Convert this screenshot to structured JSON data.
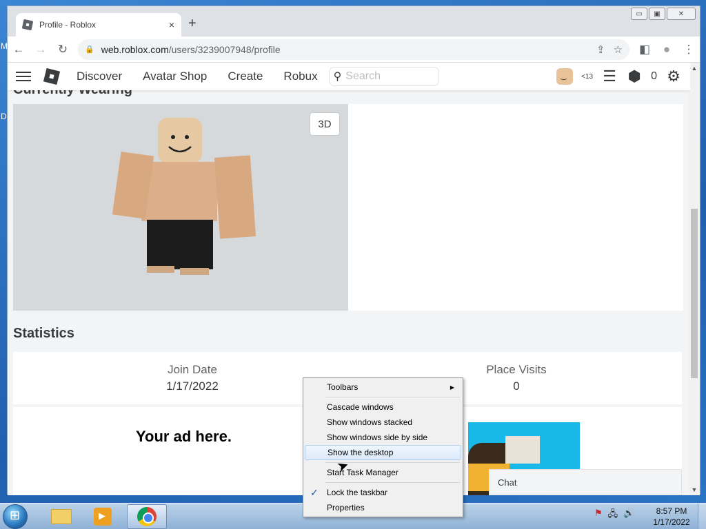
{
  "desktop": {
    "edge_letters": [
      "M",
      "D"
    ]
  },
  "browser": {
    "tab_title": "Profile - Roblox",
    "tab_close": "×",
    "new_tab": "+",
    "window_controls": {
      "minimize": "▭",
      "maximize": "▣",
      "close": "✕"
    },
    "nav": {
      "back": "←",
      "forward": "→",
      "reload": "↻"
    },
    "url_host": "web.roblox.com",
    "url_path": "/users/3239007948/profile",
    "omni_icons": {
      "share": "⇪",
      "bookmark": "☆"
    },
    "toolbar_icons": {
      "sidepanel": "◧",
      "profile": "●",
      "menu": "⋮"
    }
  },
  "roblox": {
    "nav_items": [
      "Discover",
      "Avatar Shop",
      "Create",
      "Robux"
    ],
    "search_placeholder": "Search",
    "age_tag": "<13",
    "robux_count": "0",
    "section_peek": "Currently Wearing",
    "btn_3d": "3D",
    "stats_title": "Statistics",
    "stats": [
      {
        "label": "Join Date",
        "value": "1/17/2022"
      },
      {
        "label": "Place Visits",
        "value": "0"
      }
    ],
    "ad_text": "Your ad here.",
    "chat_label": "Chat"
  },
  "context_menu": {
    "items": [
      {
        "label": "Toolbars",
        "submenu": true
      },
      {
        "label": "Cascade windows"
      },
      {
        "label": "Show windows stacked"
      },
      {
        "label": "Show windows side by side"
      },
      {
        "label": "Show the desktop",
        "highlighted": true
      },
      {
        "label": "Start Task Manager"
      },
      {
        "label": "Lock the taskbar",
        "checked": true
      },
      {
        "label": "Properties"
      }
    ]
  },
  "taskbar": {
    "clock_time": "8:57 PM",
    "clock_date": "1/17/2022"
  }
}
